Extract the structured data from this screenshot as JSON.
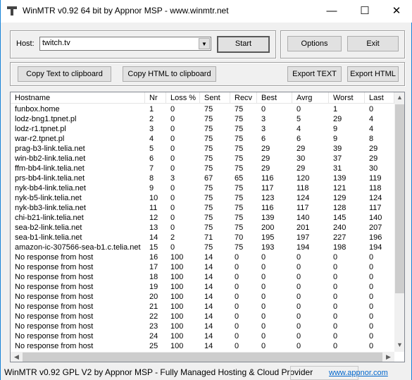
{
  "window": {
    "title": "WinMTR v0.92 64 bit by Appnor MSP - www.winmtr.net",
    "minimize": "—",
    "maximize": "☐",
    "close": "✕"
  },
  "toolbar": {
    "host_label": "Host:",
    "host_value": "twitch.tv",
    "start": "Start",
    "options": "Options",
    "exit": "Exit",
    "copy_text": "Copy Text to clipboard",
    "copy_html": "Copy HTML to clipboard",
    "export_text": "Export TEXT",
    "export_html": "Export HTML"
  },
  "table": {
    "columns": [
      "Hostname",
      "Nr",
      "Loss %",
      "Sent",
      "Recv",
      "Best",
      "Avrg",
      "Worst",
      "Last"
    ],
    "rows": [
      [
        "funbox.home",
        "1",
        "0",
        "75",
        "75",
        "0",
        "0",
        "1",
        "0"
      ],
      [
        "lodz-bng1.tpnet.pl",
        "2",
        "0",
        "75",
        "75",
        "3",
        "5",
        "29",
        "4"
      ],
      [
        "lodz-r1.tpnet.pl",
        "3",
        "0",
        "75",
        "75",
        "3",
        "4",
        "9",
        "4"
      ],
      [
        "war-r2.tpnet.pl",
        "4",
        "0",
        "75",
        "75",
        "6",
        "6",
        "9",
        "8"
      ],
      [
        "prag-b3-link.telia.net",
        "5",
        "0",
        "75",
        "75",
        "29",
        "29",
        "39",
        "29"
      ],
      [
        "win-bb2-link.telia.net",
        "6",
        "0",
        "75",
        "75",
        "29",
        "30",
        "37",
        "29"
      ],
      [
        "ffm-bb4-link.telia.net",
        "7",
        "0",
        "75",
        "75",
        "29",
        "29",
        "31",
        "30"
      ],
      [
        "prs-bb4-link.telia.net",
        "8",
        "3",
        "67",
        "65",
        "116",
        "120",
        "139",
        "119"
      ],
      [
        "nyk-bb4-link.telia.net",
        "9",
        "0",
        "75",
        "75",
        "117",
        "118",
        "121",
        "118"
      ],
      [
        "nyk-b5-link.telia.net",
        "10",
        "0",
        "75",
        "75",
        "123",
        "124",
        "129",
        "124"
      ],
      [
        "nyk-bb3-link.telia.net",
        "11",
        "0",
        "75",
        "75",
        "116",
        "117",
        "128",
        "117"
      ],
      [
        "chi-b21-link.telia.net",
        "12",
        "0",
        "75",
        "75",
        "139",
        "140",
        "145",
        "140"
      ],
      [
        "sea-b2-link.telia.net",
        "13",
        "0",
        "75",
        "75",
        "200",
        "201",
        "240",
        "207"
      ],
      [
        "sea-b1-link.telia.net",
        "14",
        "2",
        "71",
        "70",
        "195",
        "197",
        "227",
        "196"
      ],
      [
        "amazon-ic-307566-sea-b1.c.telia.net",
        "15",
        "0",
        "75",
        "75",
        "193",
        "194",
        "198",
        "194"
      ],
      [
        "No response from host",
        "16",
        "100",
        "14",
        "0",
        "0",
        "0",
        "0",
        "0"
      ],
      [
        "No response from host",
        "17",
        "100",
        "14",
        "0",
        "0",
        "0",
        "0",
        "0"
      ],
      [
        "No response from host",
        "18",
        "100",
        "14",
        "0",
        "0",
        "0",
        "0",
        "0"
      ],
      [
        "No response from host",
        "19",
        "100",
        "14",
        "0",
        "0",
        "0",
        "0",
        "0"
      ],
      [
        "No response from host",
        "20",
        "100",
        "14",
        "0",
        "0",
        "0",
        "0",
        "0"
      ],
      [
        "No response from host",
        "21",
        "100",
        "14",
        "0",
        "0",
        "0",
        "0",
        "0"
      ],
      [
        "No response from host",
        "22",
        "100",
        "14",
        "0",
        "0",
        "0",
        "0",
        "0"
      ],
      [
        "No response from host",
        "23",
        "100",
        "14",
        "0",
        "0",
        "0",
        "0",
        "0"
      ],
      [
        "No response from host",
        "24",
        "100",
        "14",
        "0",
        "0",
        "0",
        "0",
        "0"
      ],
      [
        "No response from host",
        "25",
        "100",
        "14",
        "0",
        "0",
        "0",
        "0",
        "0"
      ]
    ]
  },
  "statusbar": {
    "text": "WinMTR v0.92 GPL V2 by Appnor MSP - Fully Managed Hosting & Cloud Provider",
    "link": "www.appnor.com"
  }
}
